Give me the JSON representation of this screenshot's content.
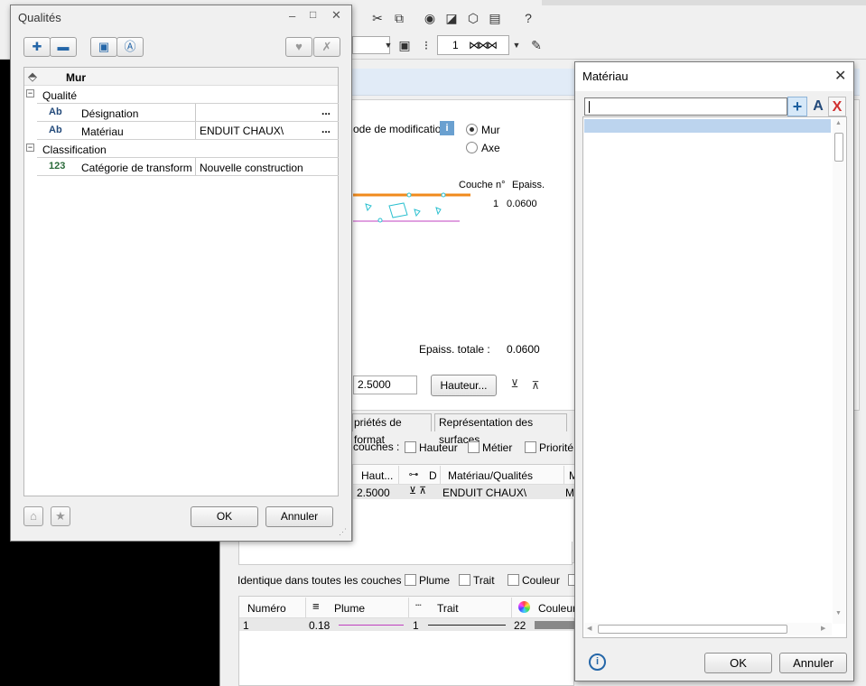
{
  "toolbar": {
    "field_value": "1",
    "icons": [
      "scissors-icon",
      "copy-icon",
      "eye-icon",
      "chart-icon",
      "cube-icon",
      "layer-icon",
      "ruler-icon",
      "help-icon"
    ]
  },
  "background_dialog": {
    "mode_label": "ode de modification",
    "radio_wall": "Mur",
    "radio_axis": "Axe",
    "col_layer": "Couche n°",
    "col_thickness": "Epaiss.",
    "layer_num": "1",
    "layer_thickness": "0.0600",
    "total_label": "Epaiss. totale :",
    "total_value": "0.0600",
    "height_value": "2.5000",
    "height_button": "Hauteur...",
    "tabs": [
      "priétés de format",
      "Représentation des surfaces"
    ],
    "layers_label": "couches :",
    "check_height": "Hauteur",
    "check_trade": "Métier",
    "check_priority": "Priorité",
    "table_headers": [
      "Haut...",
      "D",
      "Matériau/Qualités",
      "M"
    ],
    "table_row": {
      "height": "2.5000",
      "material": "ENDUIT CHAUX\\",
      "m": "Me"
    },
    "identical_label": "Identique dans toutes les couches :",
    "check_pen": "Plume",
    "check_line": "Trait",
    "check_color": "Couleur",
    "pen_headers": [
      "Numéro",
      "Plume",
      "Trait",
      "Couleur"
    ],
    "pen_row": {
      "num": "1",
      "pen": "0.18",
      "line": "1",
      "color": "22"
    }
  },
  "qualites_dialog": {
    "title": "Qualités",
    "header": "Mur",
    "groups": [
      {
        "name": "Qualité"
      },
      {
        "name": "Classification"
      }
    ],
    "rows": [
      {
        "icon": "Ab",
        "label": "Désignation",
        "value": ""
      },
      {
        "icon": "Ab",
        "label": "Matériau",
        "value": "ENDUIT CHAUX\\"
      },
      {
        "icon": "123",
        "label": "Catégorie de transform",
        "value": "Nouvelle construction"
      }
    ],
    "ellipsis": "...",
    "ok": "OK",
    "cancel": "Annuler"
  },
  "materiau_dialog": {
    "title": "Matériau",
    "search_value": "",
    "ok": "OK",
    "cancel": "Annuler",
    "close_glyph": "✕",
    "add_glyph": "+",
    "text_glyph": "A",
    "delete_glyph": "X"
  },
  "colors": {
    "accent_blue": "#cce0f4",
    "selection": "#bcd4ee",
    "window_border": "#7a7a7a",
    "dark_bg": "#000000"
  }
}
